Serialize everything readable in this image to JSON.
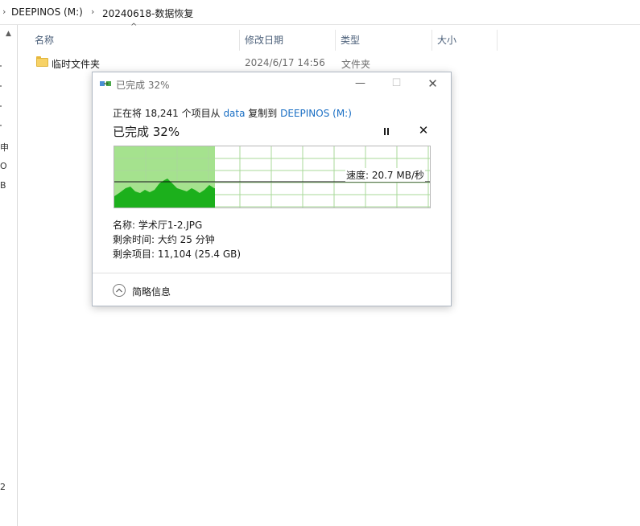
{
  "address": {
    "crumbs": [
      "DEEPINOS (M:)",
      "20240618-数据恢复"
    ]
  },
  "nav_fragments": [
    "申",
    "O",
    "B",
    "2"
  ],
  "columns": {
    "name": "名称",
    "modified": "修改日期",
    "type": "类型",
    "size": "大小"
  },
  "files": [
    {
      "name": "临时文件夹",
      "modified": "2024/6/17 14:56",
      "type": "文件夹",
      "icon": "folder-icon"
    }
  ],
  "dialog": {
    "title": "已完成 32%",
    "line_prefix": "正在将 18,241 个项目从 ",
    "source": "data",
    "line_middle": " 复制到 ",
    "destination": "DEEPINOS (M:)",
    "headline": "已完成 32%",
    "speed_label": "速度: 20.7 MB/秒",
    "name_line": "名称: 学术厅1-2.JPG",
    "time_line": "剩余时间: 大约 25 分钟",
    "items_line": "剩余项目: 11,104 (25.4 GB)",
    "details_toggle": "简略信息",
    "progress": 0.32,
    "colors": {
      "progress_fill": "#a5e28e",
      "speed_fill": "#1cb01c",
      "grid": "#a9d89a",
      "link": "#1a6fc4"
    }
  }
}
